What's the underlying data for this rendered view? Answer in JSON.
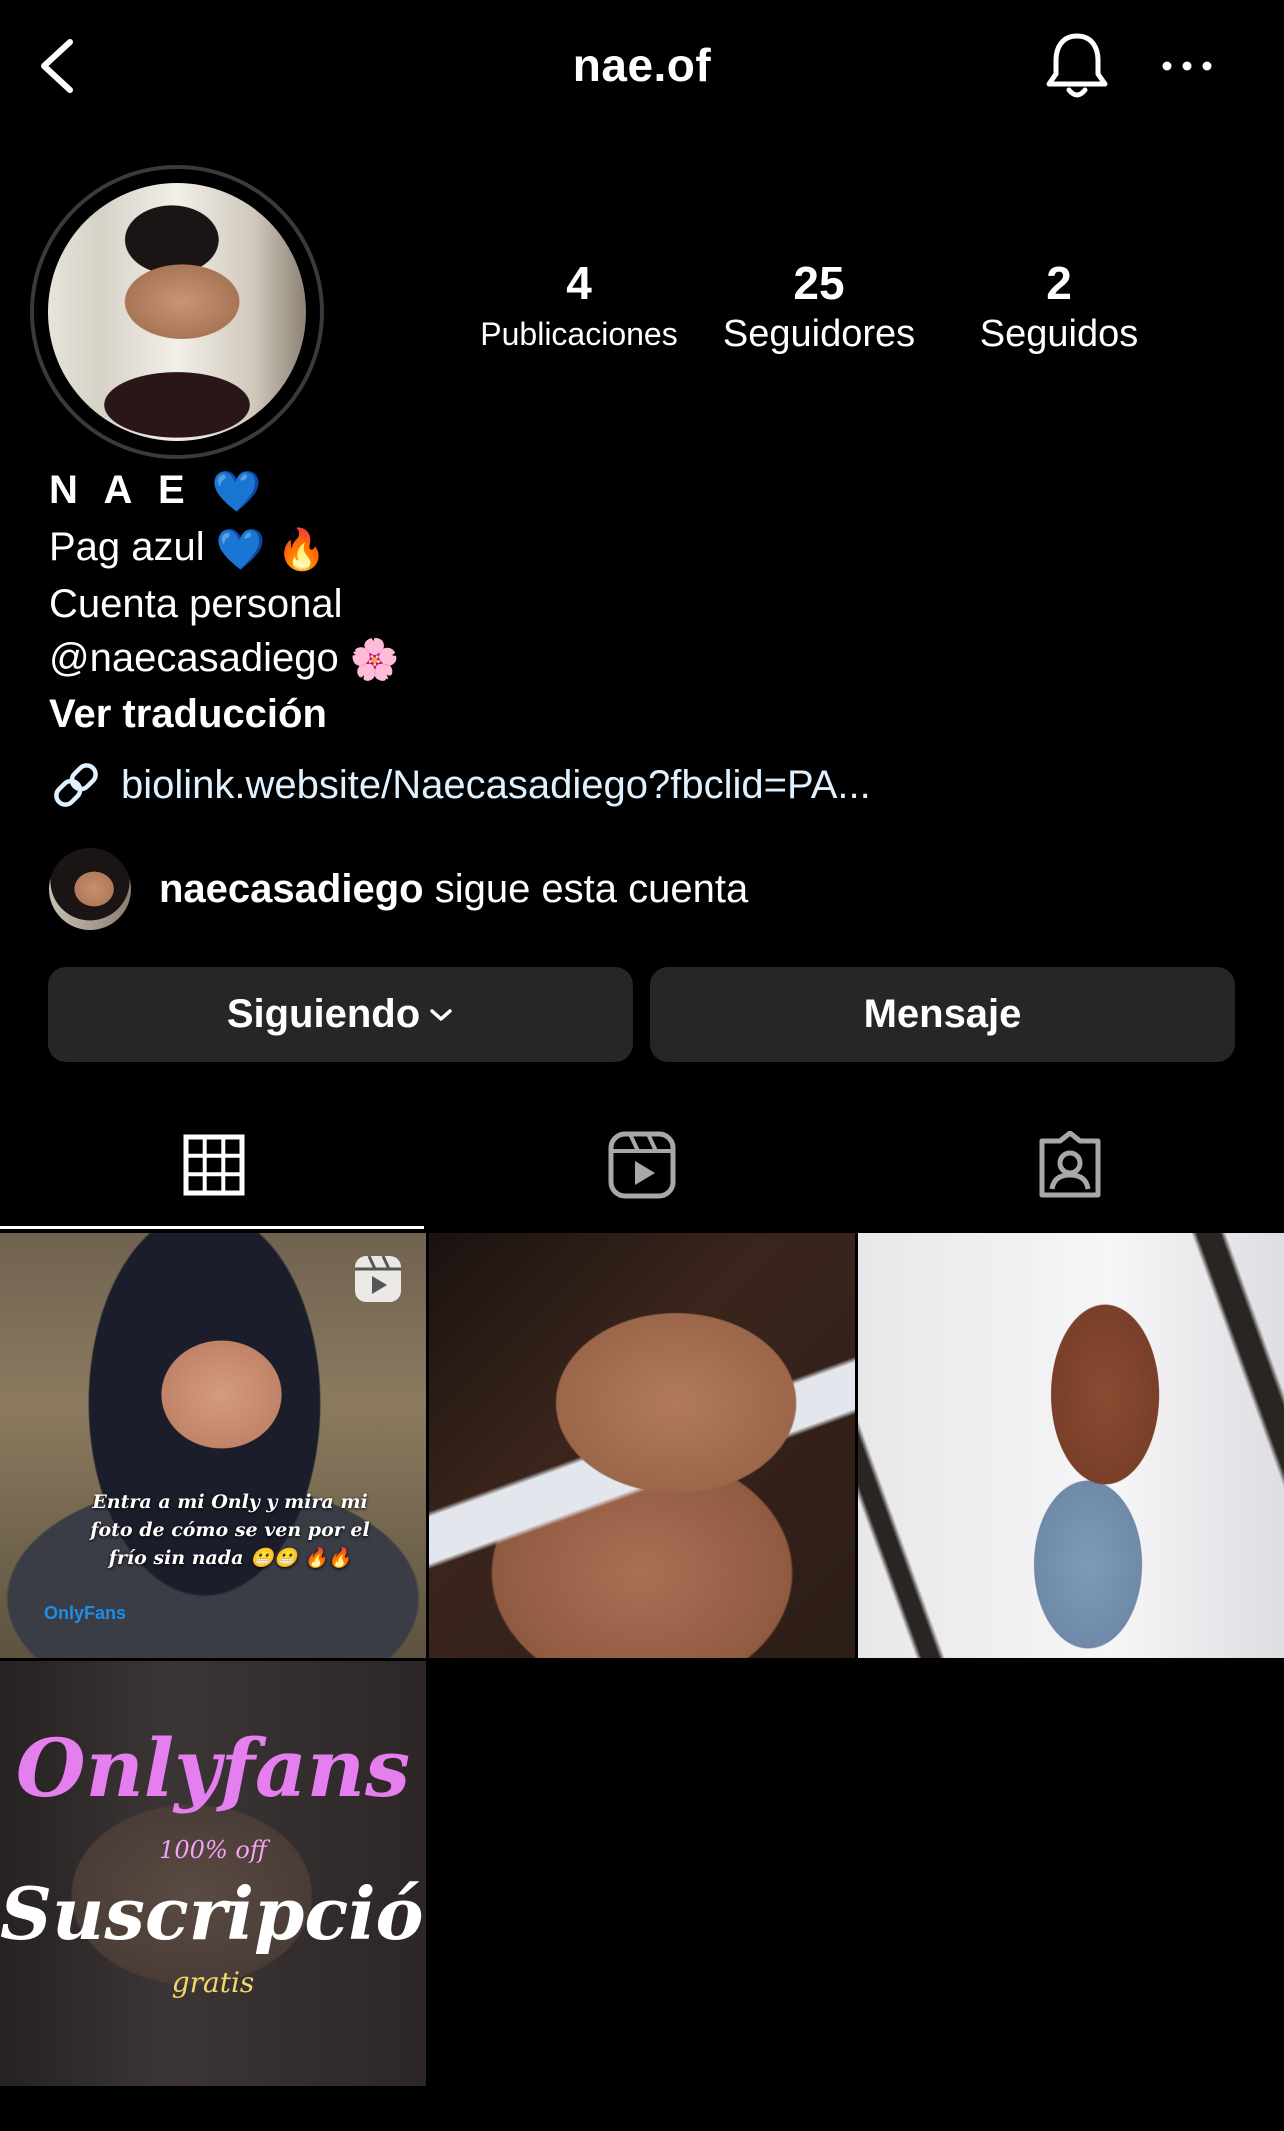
{
  "header": {
    "title": "nae.of"
  },
  "stats": {
    "posts_count": "4",
    "posts_label": "Publicaciones",
    "followers_count": "25",
    "followers_label": "Seguidores",
    "following_count": "2",
    "following_label": "Seguidos"
  },
  "bio": {
    "name": "N A E",
    "name_emoji": "💙",
    "line1": "Pag azul",
    "line1_emoji": "💙 🔥",
    "line2": "Cuenta personal",
    "line3": "@naecasadiego",
    "line3_emoji": "🌸",
    "translate": "Ver traducción"
  },
  "link": {
    "text": "biolink.website/Naecasadiego?fbclid=PA..."
  },
  "followed_by": {
    "username": "naecasadiego",
    "suffix": " sigue esta cuenta"
  },
  "actions": {
    "following_label": "Siguiendo",
    "message_label": "Mensaje"
  },
  "tabs": [
    {
      "icon": "grid-icon",
      "active": true
    },
    {
      "icon": "reels-icon",
      "active": false
    },
    {
      "icon": "tagged-icon",
      "active": false
    }
  ],
  "posts": [
    {
      "type": "reel",
      "caption": "Entra a mi Only y mira mi foto de cómo se ven por el frío sin nada 😬😬 🔥🔥",
      "watermark": "OnlyFans"
    },
    {
      "type": "photo"
    },
    {
      "type": "photo"
    },
    {
      "type": "photo",
      "title": "Onlyfans",
      "subtitle": "100% off",
      "headline": "Suscripción",
      "footer": "gratis"
    }
  ],
  "colors": {
    "background": "#000000",
    "button": "#262626",
    "link": "#e0f1ff",
    "avatar_ring": "#3a3a3a"
  }
}
